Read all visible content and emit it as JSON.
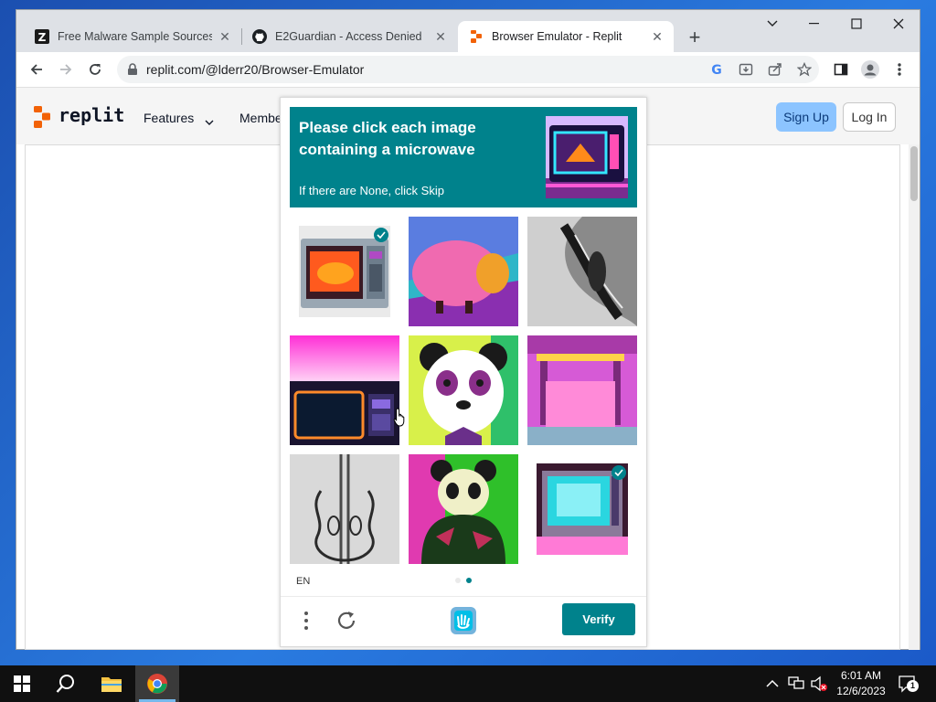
{
  "browser": {
    "tabs": [
      {
        "title": "Free Malware Sample Sources fo",
        "favicon": "zeltser-z-icon"
      },
      {
        "title": "E2Guardian - Access Denied",
        "favicon": "github-icon"
      },
      {
        "title": "Browser Emulator - Replit",
        "favicon": "replit-icon",
        "active": true
      }
    ],
    "new_tab_label": "+",
    "address": "replit.com/@lderr20/Browser-Emulator"
  },
  "site": {
    "logo_text": "replit",
    "nav": {
      "features": "Features",
      "members": "Membe"
    },
    "signup_label": "Sign Up",
    "login_label": "Log In"
  },
  "captcha": {
    "prompt_line1": "Please click each image",
    "prompt_line2": "containing a microwave",
    "prompt_sub": "If there are None, click Skip",
    "language": "EN",
    "verify_label": "Verify",
    "tiles": [
      {
        "subject": "microwave-orange",
        "selected": true
      },
      {
        "subject": "pink-sheep",
        "selected": false
      },
      {
        "subject": "violin-gray",
        "selected": false
      },
      {
        "subject": "microwave-neon",
        "selected": false
      },
      {
        "subject": "panda-face",
        "selected": false
      },
      {
        "subject": "pink-room",
        "selected": false
      },
      {
        "subject": "violin-sketch",
        "selected": false
      },
      {
        "subject": "panda-green",
        "selected": false
      },
      {
        "subject": "microwave-cyan",
        "selected": true
      }
    ],
    "page_dots": 2,
    "active_page": 2,
    "accent": "#00828c"
  },
  "taskbar": {
    "time": "6:01 AM",
    "date": "12/6/2023",
    "notification_count": "1"
  }
}
